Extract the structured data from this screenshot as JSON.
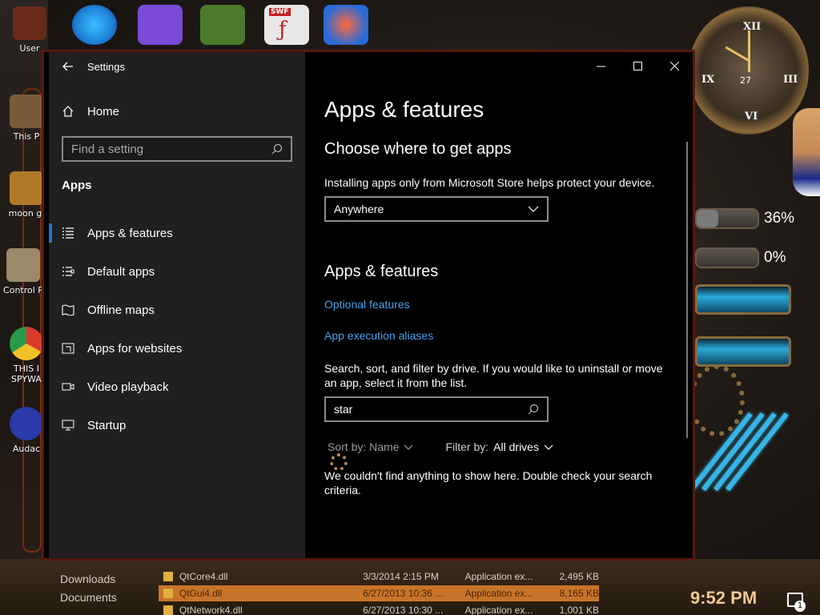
{
  "desktop": {
    "left_icons": [
      {
        "label": "User"
      },
      {
        "label": "This P"
      },
      {
        "label": "moon gi"
      },
      {
        "label": "Control P"
      },
      {
        "label": "THIS I SPYWA"
      },
      {
        "label": "Audac"
      }
    ],
    "top_icons": [
      {
        "label": "",
        "color": "#1e7fd4"
      },
      {
        "label": "",
        "color": "#7a4ad8"
      },
      {
        "label": "",
        "color": "#4a7a2a"
      },
      {
        "label": "SWF",
        "color": "#d8d8d8"
      },
      {
        "label": "",
        "color": "#2a6ad8"
      }
    ],
    "clock": {
      "date": "27"
    },
    "gauges": [
      {
        "percent_text": "36%",
        "fill": 0.36,
        "color": "#7a7a7a"
      },
      {
        "percent_text": "0%",
        "fill": 0.0,
        "color": "#3aa04a"
      }
    ]
  },
  "explorer_behind": {
    "nav": [
      "Downloads",
      "Documents"
    ],
    "files": [
      {
        "name": "QtCore4.dll",
        "date": "3/3/2014 2:15 PM",
        "type": "Application ex...",
        "size": "2,495 KB",
        "selected": false
      },
      {
        "name": "QtGui4.dll",
        "date": "6/27/2013 10:36 ...",
        "type": "Application ex...",
        "size": "8,165 KB",
        "selected": true
      },
      {
        "name": "QtNetwork4.dll",
        "date": "6/27/2013 10:30 ...",
        "type": "Application ex...",
        "size": "1,001 KB",
        "selected": false
      }
    ]
  },
  "taskbar": {
    "time": "9:52 PM",
    "notification_count": "1"
  },
  "settings": {
    "window_title": "Settings",
    "back_icon": "back-arrow-icon",
    "controls": {
      "minimize": "—",
      "maximize": "☐",
      "close": "✕"
    },
    "sidebar": {
      "home": "Home",
      "search_placeholder": "Find a setting",
      "section": "Apps",
      "items": [
        {
          "label": "Apps & features",
          "icon": "apps-features-icon",
          "active": true
        },
        {
          "label": "Default apps",
          "icon": "default-apps-icon",
          "active": false
        },
        {
          "label": "Offline maps",
          "icon": "offline-maps-icon",
          "active": false
        },
        {
          "label": "Apps for websites",
          "icon": "apps-websites-icon",
          "active": false
        },
        {
          "label": "Video playback",
          "icon": "video-playback-icon",
          "active": false
        },
        {
          "label": "Startup",
          "icon": "startup-icon",
          "active": false
        }
      ]
    },
    "main": {
      "page_title": "Apps & features",
      "choose_heading": "Choose where to get apps",
      "choose_desc": "Installing apps only from Microsoft Store helps protect your device.",
      "source_dropdown": "Anywhere",
      "apps_heading": "Apps & features",
      "optional_features": "Optional features",
      "aliases": "App execution aliases",
      "search_desc": "Search, sort, and filter by drive. If you would like to uninstall or move an app, select it from the list.",
      "search_value": "star",
      "sort_label": "Sort by: Name",
      "filter_label": "Filter by:",
      "filter_value": "All drives",
      "empty_message": "We couldn't find anything to show here. Double check your search criteria."
    }
  },
  "colors": {
    "accent": "#1e78d4",
    "link": "#4aa0ea",
    "sidebar_bg": "#202020",
    "content_bg": "#000000"
  }
}
